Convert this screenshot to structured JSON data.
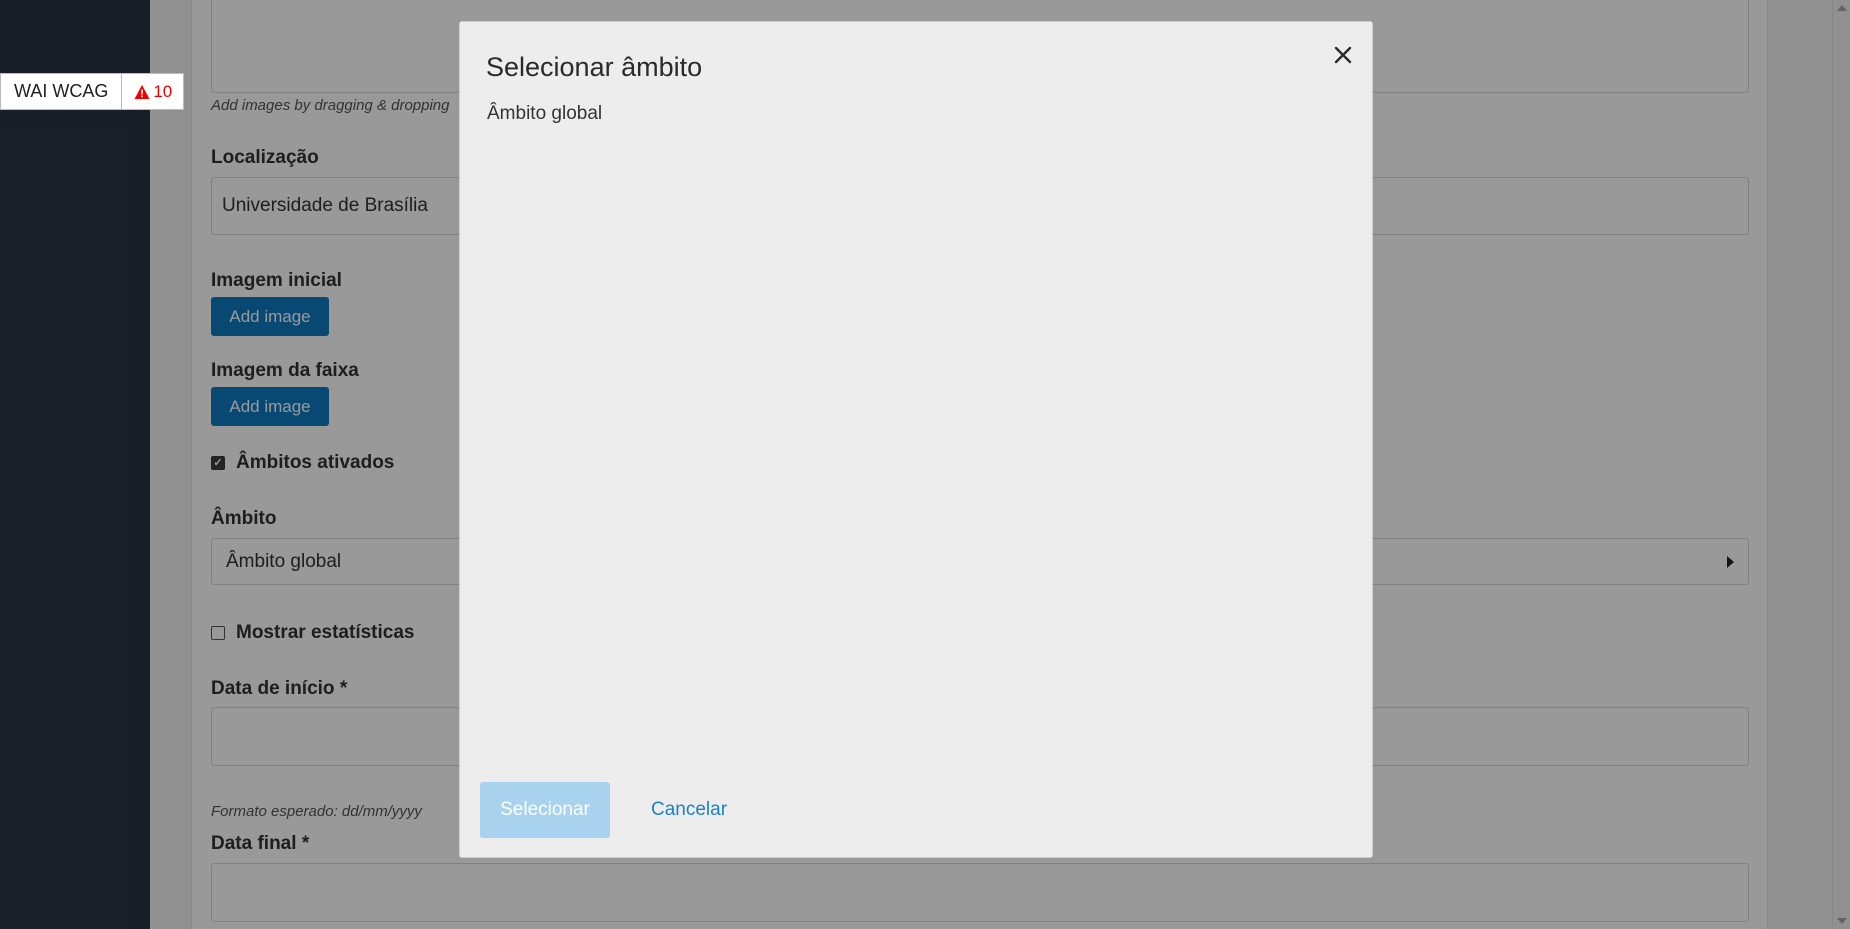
{
  "wcag_badge": {
    "label": "WAI WCAG",
    "count": "10"
  },
  "form": {
    "image_hint": "Add images by dragging & dropping",
    "location": {
      "label": "Localização",
      "value": "Universidade de Brasília"
    },
    "initial_image": {
      "label": "Imagem inicial",
      "button": "Add image"
    },
    "banner_image": {
      "label": "Imagem da faixa",
      "button": "Add image"
    },
    "scopes_enabled": {
      "label": "Âmbitos ativados",
      "checked": true
    },
    "scope": {
      "label": "Âmbito",
      "value": "Âmbito global"
    },
    "show_stats": {
      "label": "Mostrar estatísticas",
      "checked": false
    },
    "start_date": {
      "label": "Data de início",
      "required_mark": "*",
      "hint": "Formato esperado: dd/mm/yyyy"
    },
    "end_date": {
      "label": "Data final",
      "required_mark": "*"
    }
  },
  "modal": {
    "title": "Selecionar âmbito",
    "items": [
      "Âmbito global"
    ],
    "select_label": "Selecionar",
    "cancel_label": "Cancelar"
  },
  "colors": {
    "primary": "#0e7bc0",
    "sidebar": "#2b3240",
    "link": "#1a82c4",
    "alert": "#e00000"
  }
}
